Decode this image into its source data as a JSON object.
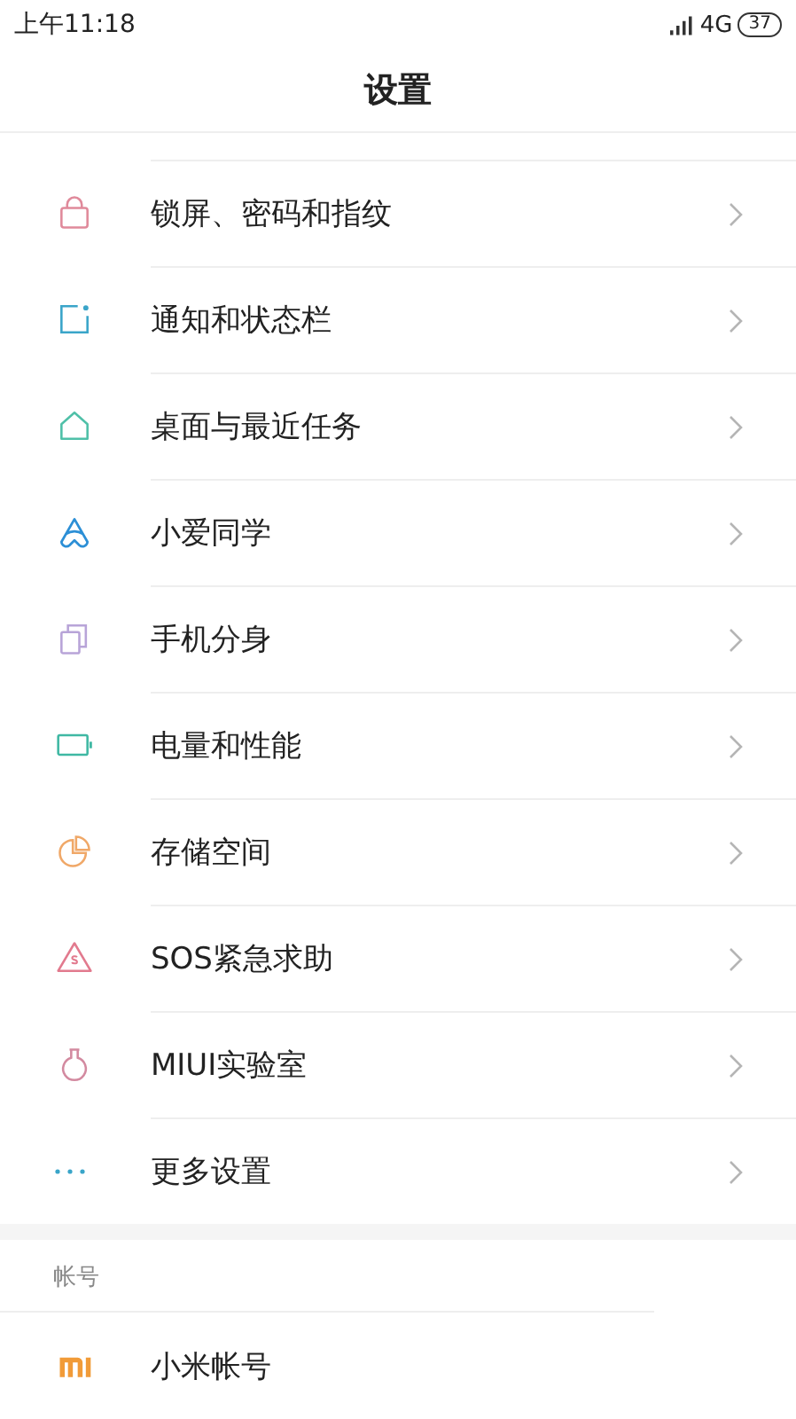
{
  "status_bar": {
    "time": "上午11:18",
    "network": "4G",
    "battery": "37"
  },
  "title": "设置",
  "sections": [
    {
      "items": [
        {
          "label": "锁屏、密码和指纹"
        },
        {
          "label": "通知和状态栏"
        },
        {
          "label": "桌面与最近任务"
        },
        {
          "label": "小爱同学"
        },
        {
          "label": "手机分身"
        },
        {
          "label": "电量和性能"
        },
        {
          "label": "存储空间"
        },
        {
          "label": "SOS紧急求助"
        },
        {
          "label": "MIUI实验室"
        },
        {
          "label": "更多设置"
        }
      ]
    },
    {
      "header": "帐号",
      "items": [
        {
          "label": "小米帐号"
        }
      ]
    }
  ]
}
